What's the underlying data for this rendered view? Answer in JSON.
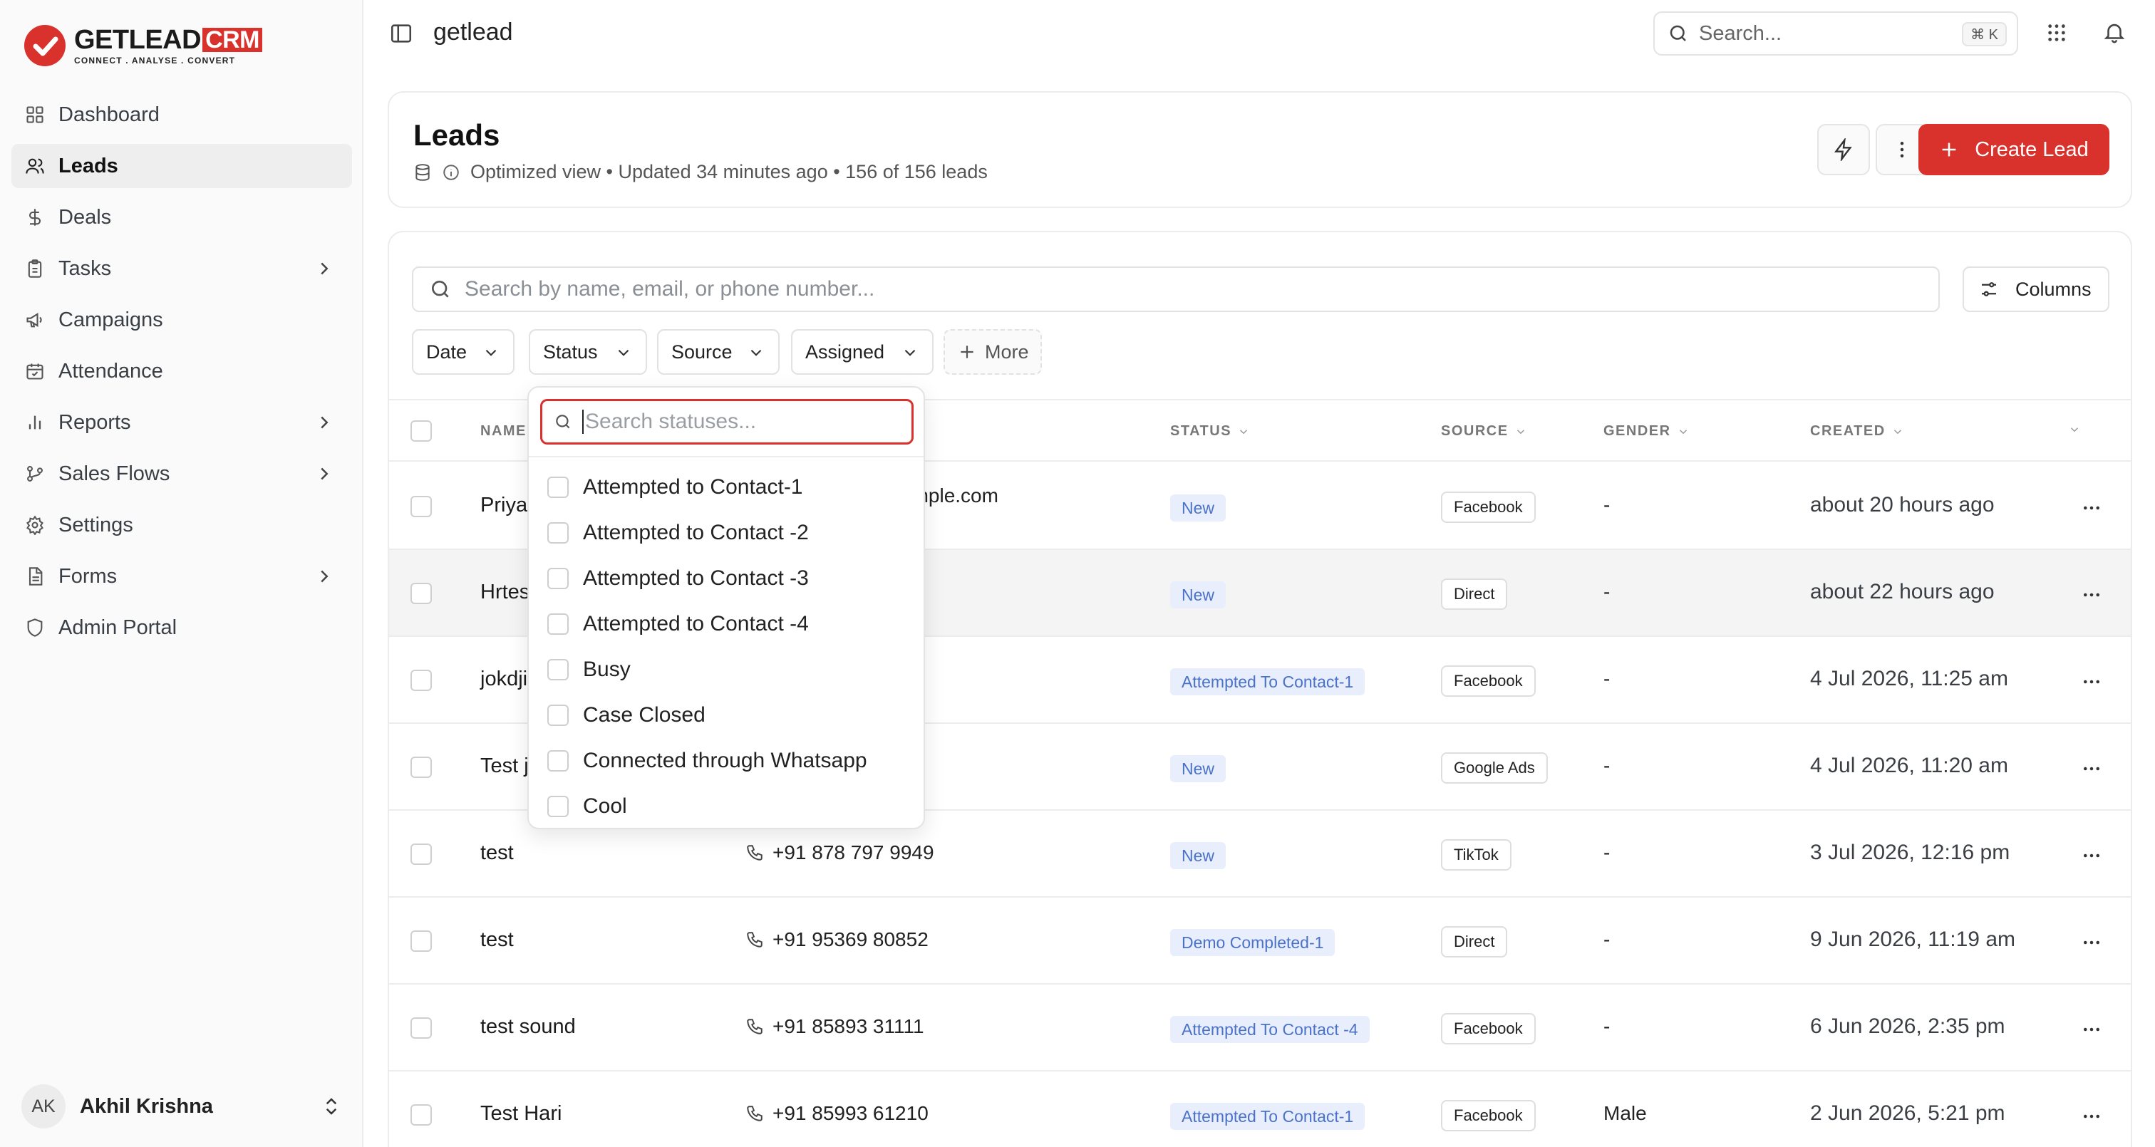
{
  "brand": {
    "name": "GETLEAD",
    "badge": "CRM",
    "tagline": "CONNECT . ANALYSE . CONVERT",
    "accent": "#d9312c"
  },
  "sidebar": {
    "items": [
      {
        "label": "Dashboard",
        "icon": "grid-icon",
        "active": false,
        "has_children": false
      },
      {
        "label": "Leads",
        "icon": "users-icon",
        "active": true,
        "has_children": false
      },
      {
        "label": "Deals",
        "icon": "dollar-icon",
        "active": false,
        "has_children": false
      },
      {
        "label": "Tasks",
        "icon": "clipboard-icon",
        "active": false,
        "has_children": true
      },
      {
        "label": "Campaigns",
        "icon": "megaphone-icon",
        "active": false,
        "has_children": false
      },
      {
        "label": "Attendance",
        "icon": "calendar-check-icon",
        "active": false,
        "has_children": false
      },
      {
        "label": "Reports",
        "icon": "bar-chart-icon",
        "active": false,
        "has_children": true
      },
      {
        "label": "Sales Flows",
        "icon": "git-branch-icon",
        "active": false,
        "has_children": true
      },
      {
        "label": "Settings",
        "icon": "gear-icon",
        "active": false,
        "has_children": false
      },
      {
        "label": "Forms",
        "icon": "file-icon",
        "active": false,
        "has_children": true
      },
      {
        "label": "Admin Portal",
        "icon": "shield-icon",
        "active": false,
        "has_children": false
      }
    ],
    "user": {
      "initials": "AK",
      "name": "Akhil Krishna"
    }
  },
  "topbar": {
    "workspace": "getlead",
    "search_placeholder": "Search...",
    "shortcut": "⌘ K"
  },
  "header": {
    "title": "Leads",
    "subtitle": "Optimized view • Updated 34 minutes ago • 156 of 156 leads",
    "create_label": "Create Lead"
  },
  "toolbar": {
    "search_placeholder": "Search by name, email, or phone number...",
    "columns_label": "Columns",
    "filters": {
      "date": "Date",
      "status": "Status",
      "source": "Source",
      "assigned": "Assigned",
      "more": "More"
    }
  },
  "table": {
    "columns": {
      "name": "NAME",
      "status": "STATUS",
      "source": "SOURCE",
      "gender": "GENDER",
      "created": "CREATED"
    },
    "rows": [
      {
        "name": "Priya",
        "contact": "xample.com",
        "contact_type": "email",
        "status": "New",
        "source": "Facebook",
        "gender": "-",
        "created": "about 20 hours ago"
      },
      {
        "name": "Hrtes",
        "contact": "",
        "contact_type": "none",
        "status": "New",
        "source": "Direct",
        "gender": "-",
        "created": "about 22 hours ago"
      },
      {
        "name": "jokdji",
        "contact": "",
        "contact_type": "none",
        "status": "Attempted To Contact-1",
        "source": "Facebook",
        "gender": "-",
        "created": "4 Jul 2026, 11:25 am"
      },
      {
        "name": "Test j",
        "contact": "",
        "contact_type": "none",
        "status": "New",
        "source": "Google Ads",
        "gender": "-",
        "created": "4 Jul 2026, 11:20 am"
      },
      {
        "name": "test",
        "contact": "+91 878 797 9949",
        "contact_type": "phone",
        "status": "New",
        "source": "TikTok",
        "gender": "-",
        "created": "3 Jul 2026, 12:16 pm"
      },
      {
        "name": "test",
        "contact": "+91 95369 80852",
        "contact_type": "phone",
        "status": "Demo Completed-1",
        "source": "Direct",
        "gender": "-",
        "created": "9 Jun 2026, 11:19 am"
      },
      {
        "name": "test sound",
        "contact": "+91 85893 31111",
        "contact_type": "phone",
        "status": "Attempted To Contact -4",
        "source": "Facebook",
        "gender": "-",
        "created": "6 Jun 2026, 2:35 pm"
      },
      {
        "name": "Test Hari",
        "contact": "+91 85993 61210",
        "contact_type": "phone",
        "status": "Attempted To Contact-1",
        "source": "Facebook",
        "gender": "Male",
        "created": "2 Jun 2026, 5:21 pm"
      }
    ]
  },
  "status_dropdown": {
    "search_placeholder": "Search statuses...",
    "options": [
      "Attempted to Contact-1",
      "Attempted to Contact -2",
      "Attempted to Contact -3",
      "Attempted to Contact -4",
      "Busy",
      "Case Closed",
      "Connected through Whatsapp",
      "Cool"
    ]
  }
}
